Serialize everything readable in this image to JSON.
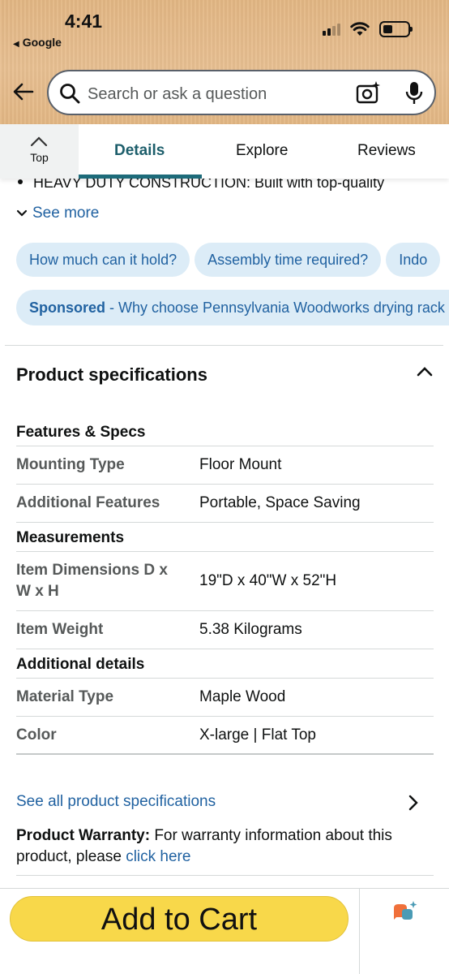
{
  "status_bar": {
    "time": "4:41",
    "back_app": "Google",
    "back_app_glyph": "◀"
  },
  "search": {
    "placeholder": "Search or ask a question",
    "icons": [
      "back-arrow-icon",
      "search-icon",
      "camera-sparkle-icon",
      "microphone-icon"
    ]
  },
  "tabs": {
    "top_label": "Top",
    "items": [
      "Details",
      "Explore",
      "Reviews"
    ],
    "active": "Details"
  },
  "content": {
    "bullet_text": "HEAVY DUTY CONSTRUCTION: Built with top-quality",
    "see_more": "See more",
    "chips": [
      "How much can it hold?",
      "Assembly time required?",
      "Indo"
    ],
    "sponsored_label": "Sponsored",
    "sponsored_text": " - Why choose Pennsylvania Woodworks drying rack"
  },
  "specs": {
    "title": "Product specifications",
    "sections": [
      {
        "heading": "Features & Specs",
        "rows": [
          {
            "key": "Mounting Type",
            "value": "Floor Mount"
          },
          {
            "key": "Additional Features",
            "value": "Portable, Space Saving"
          }
        ]
      },
      {
        "heading": "Measurements",
        "rows": [
          {
            "key": "Item Dimensions D x W x H",
            "value": "19\"D x 40\"W x 52\"H"
          },
          {
            "key": "Item Weight",
            "value": "5.38 Kilograms"
          }
        ]
      },
      {
        "heading": "Additional details",
        "rows": [
          {
            "key": "Material Type",
            "value": "Maple Wood"
          },
          {
            "key": "Color",
            "value": "X-large | Flat Top"
          }
        ]
      }
    ],
    "see_all": "See all product specifications",
    "warranty_label": "Product Warranty:",
    "warranty_text": " For warranty information about this product, please ",
    "warranty_link": "click here"
  },
  "bottom": {
    "cart_button": "Add to Cart"
  },
  "colors": {
    "header_bg": "#e6bd8c",
    "link": "#2162a1",
    "tab_active": "#1d5e6b",
    "cart_button": "#f8d84a",
    "chip_bg": "#dcecf7"
  }
}
